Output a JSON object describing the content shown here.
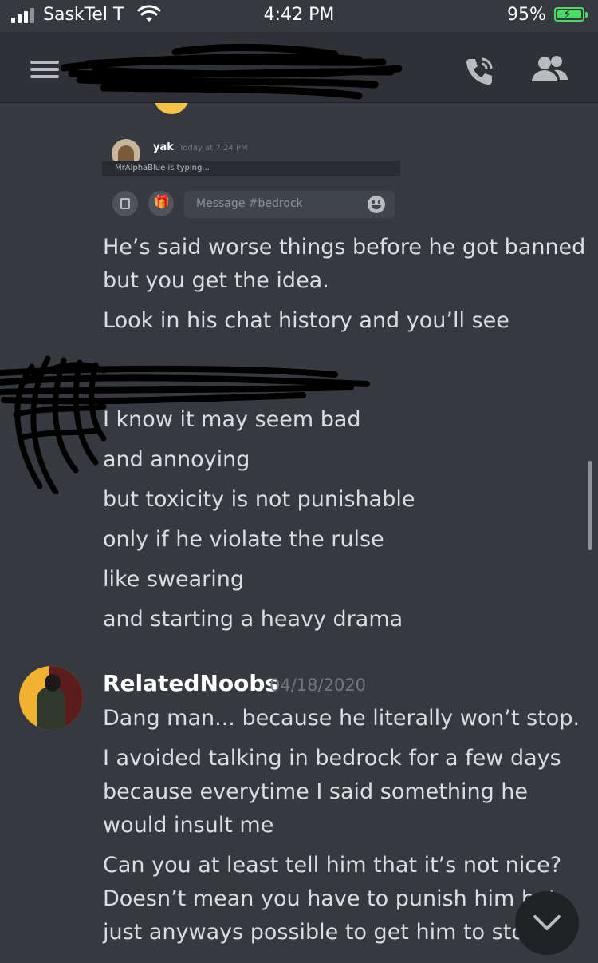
{
  "status_bar": {
    "carrier": "SaskTel T",
    "time": "4:42 PM",
    "battery_percent": "95%"
  },
  "header": {
    "channel_name_redacted": true
  },
  "embedded_screenshot": {
    "username": "yak",
    "timestamp": "Today at 7:24 PM",
    "typing_indicator": "MrAlphaBlue is typing...",
    "input_placeholder": "Message #bedrock"
  },
  "messages_top": {
    "lines": [
      "He’s said worse things before he got banned",
      "but you get the idea.",
      "Look in his chat history and you’ll see"
    ]
  },
  "messages_redacted_author": {
    "lines": [
      "I know it may seem bad",
      "and annoying",
      "but toxicity is not punishable",
      "only if he violate the rulse",
      "like swearing",
      "and starting a heavy drama"
    ]
  },
  "message_group": {
    "author": "RelatedNoobs",
    "date": "04/18/2020",
    "lines": [
      "Dang man...  because he literally won’t stop.",
      "I avoided talking in bedrock for a few days",
      "because everytime I said something he",
      "would insult me",
      "Can you at least tell him that it’s not nice?",
      "Doesn’t mean you have to punish him but",
      "just anyways possible to get him to stop"
    ]
  }
}
